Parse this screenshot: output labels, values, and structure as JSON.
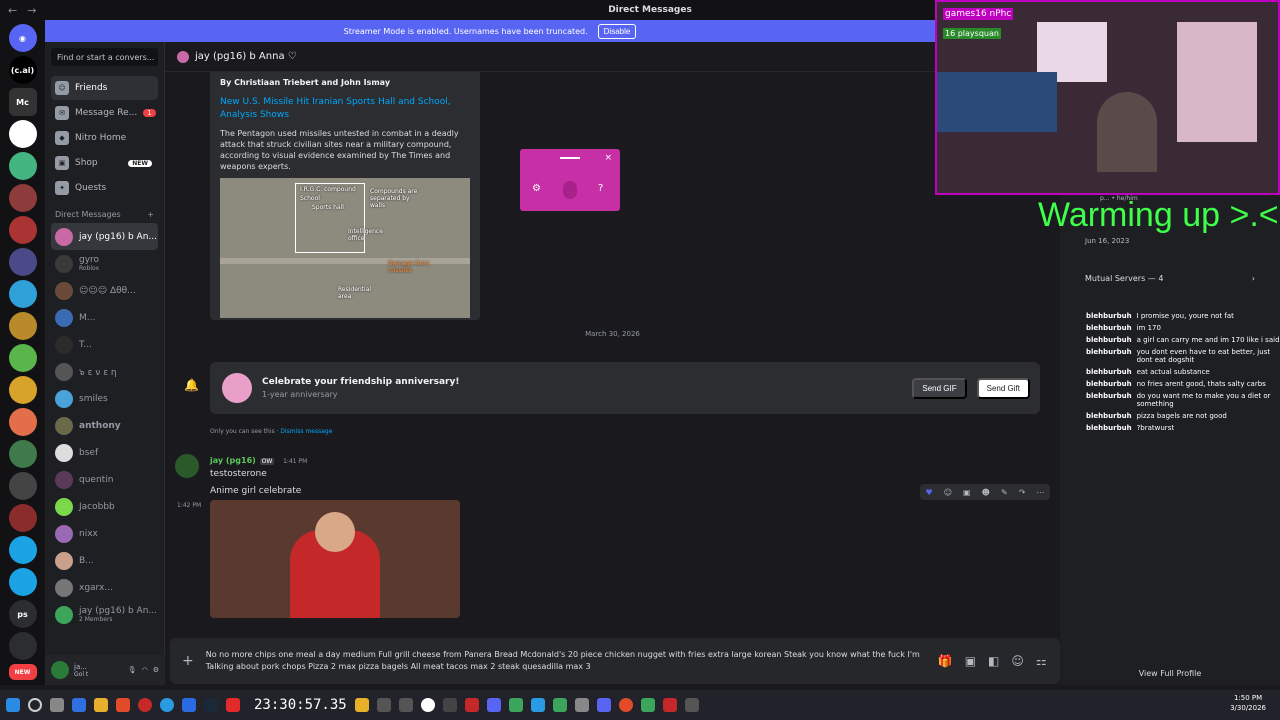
{
  "titlebar": {
    "title": "Direct Messages"
  },
  "banner": {
    "text": "Streamer Mode is enabled. Usernames have been truncated.",
    "disable": "Disable"
  },
  "servers": {
    "items": [
      "(c.ai)",
      "Mc",
      "ps",
      "NEW"
    ]
  },
  "search": {
    "placeholder": "Find or start a convers..."
  },
  "nav": {
    "friends": "Friends",
    "message_requests": "Message Re...",
    "message_requests_count": "1",
    "nitro": "Nitro Home",
    "shop": "Shop",
    "shop_badge": "NEW",
    "quests": "Quests"
  },
  "dm_header": "Direct Messages",
  "dms": [
    {
      "name": "jay (pg16) b An..."
    },
    {
      "name": "gyro",
      "sub": "Roblox"
    },
    {
      "name": "☺☺☺ Δθθ..."
    },
    {
      "name": "M..."
    },
    {
      "name": "T..."
    },
    {
      "name": "๖ ε ν ε η"
    },
    {
      "name": "smiles"
    },
    {
      "name": "anthony"
    },
    {
      "name": "bsef"
    },
    {
      "name": "quentin"
    },
    {
      "name": "Jacobbb"
    },
    {
      "name": "nixx"
    },
    {
      "name": "B..."
    },
    {
      "name": "xgarx..."
    },
    {
      "name": "jay (pg16) b An...",
      "sub": "2 Members"
    }
  ],
  "user": {
    "name": "ja...",
    "status": "Gol t"
  },
  "chat": {
    "header": "jay (pg16) b Anna ♡",
    "embed": {
      "authors": "By Christiaan Triebert and John Ismay",
      "title": "New U.S. Missile Hit Iranian Sports Hall and School, Analysis Shows",
      "desc": "The Pentagon used missiles untested in combat in a deadly attack that struck civilian sites near a military compound, according to visual evidence examined by The Times and weapons experts.",
      "map_labels": [
        "I.R.G.C. compound",
        "School",
        "Sports hall",
        "Compounds are separated by walls",
        "Intelligence office",
        "Damage from missiles",
        "Residential area"
      ]
    },
    "date": "March 30, 2026",
    "anniversary": {
      "title": "Celebrate your friendship anniversary!",
      "sub": "1-year anniversary",
      "send_gif": "Send GIF",
      "send_gift": "Send Gift"
    },
    "only_you": "Only you can see this · ",
    "dismiss": "Dismiss message",
    "message": {
      "author": "jay (pg16)",
      "tag": "OW",
      "time": "1:41 PM",
      "line1": "testosterone",
      "line2": "Anime girl celebrate",
      "time2": "1:42 PM"
    },
    "composer": "No no more chips one meal a day medium Full grill cheese from Panera Bread Mcdonald's 20 piece chicken nugget with fries extra large korean Steak you know what the fuck I'm Talking about pork chops Pizza 2 max pizza bagels All meat tacos max 2 steak quesadilla max 3"
  },
  "overlay": {
    "warming": "Warming up >.<",
    "handle": "p... • he/him",
    "member_since": "Jun 16, 2023",
    "mutual": "Mutual Servers — 4",
    "view_profile": "View Full Profile",
    "cam_text": "games16 nPhc",
    "cam_sub": "16 playsquan"
  },
  "twitch_chat": [
    {
      "nick": "blehburbuh",
      "text": "I promise you, youre not fat"
    },
    {
      "nick": "blehburbuh",
      "text": "im 170"
    },
    {
      "nick": "blehburbuh",
      "text": "a girl can carry me and im 170 like i said"
    },
    {
      "nick": "blehburbuh",
      "text": "you dont even have to eat better, just dont eat dogshit"
    },
    {
      "nick": "blehburbuh",
      "text": "eat actual substance"
    },
    {
      "nick": "blehburbuh",
      "text": "no fries arent good, thats salty carbs"
    },
    {
      "nick": "blehburbuh",
      "text": "do you want me to make you a diet or something"
    },
    {
      "nick": "blehburbuh",
      "text": "pizza bagels are not good"
    },
    {
      "nick": "blehburbuh",
      "text": "?bratwurst"
    }
  ],
  "taskbar": {
    "time": "1:50 PM",
    "date": "3/30/2026",
    "timer": "23:30:57.35"
  }
}
